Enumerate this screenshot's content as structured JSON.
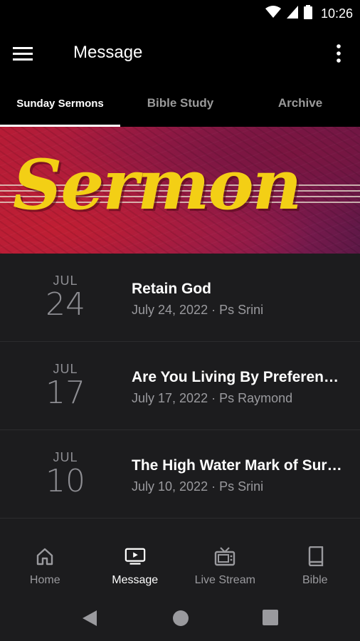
{
  "status_bar": {
    "time": "10:26",
    "icons": [
      "wifi-icon",
      "signal-icon",
      "battery-icon"
    ]
  },
  "app_bar": {
    "title": "Message",
    "menu_icon": "hamburger-menu-icon",
    "more_icon": "more-vertical-icon"
  },
  "tabs": [
    {
      "label": "Sunday Sermons",
      "active": true
    },
    {
      "label": "Bible Study",
      "active": false
    },
    {
      "label": "Archive",
      "active": false
    }
  ],
  "banner": {
    "text": "Sermon"
  },
  "sermons": [
    {
      "month": "JUL",
      "day": "24",
      "title": "Retain God",
      "meta": "July 24, 2022 · Ps Srini"
    },
    {
      "month": "JUL",
      "day": "17",
      "title": "Are You Living By Preference?",
      "meta": "July 17, 2022 · Ps Raymond"
    },
    {
      "month": "JUL",
      "day": "10",
      "title": "The High Water Mark of Surrender",
      "meta": "July 10, 2022 · Ps Srini"
    }
  ],
  "bottom_nav": [
    {
      "label": "Home",
      "icon": "home-icon",
      "active": false
    },
    {
      "label": "Message",
      "icon": "video-icon",
      "active": true
    },
    {
      "label": "Live Stream",
      "icon": "tv-icon",
      "active": false
    },
    {
      "label": "Bible",
      "icon": "book-icon",
      "active": false
    }
  ],
  "system_nav": [
    "back-icon",
    "home-circle-icon",
    "recents-icon"
  ],
  "colors": {
    "accent": "#f3cf15",
    "background": "#000000",
    "surface": "#1c1c1e",
    "muted": "#8e8e93"
  }
}
